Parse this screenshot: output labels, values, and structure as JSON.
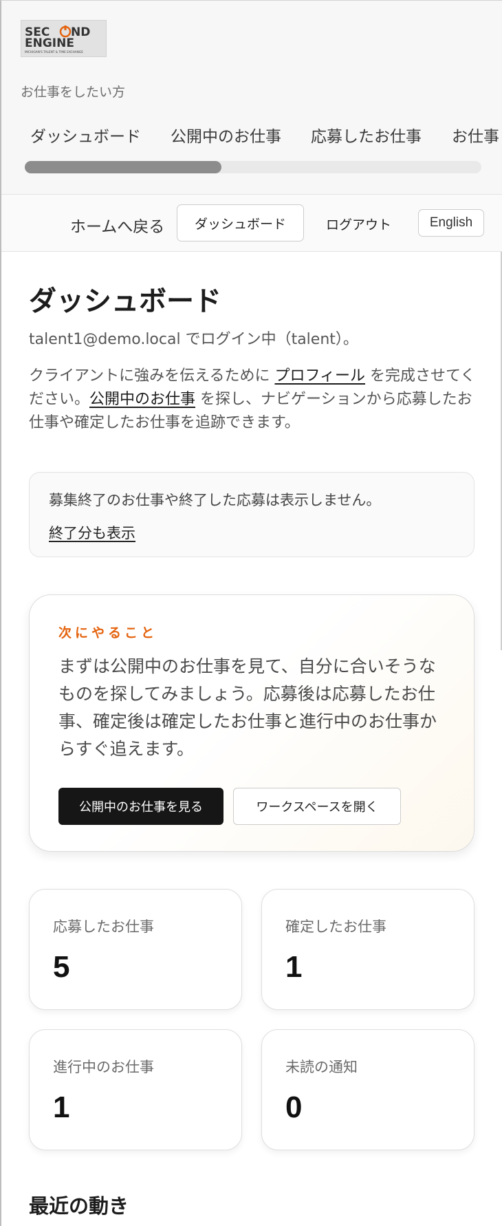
{
  "header": {
    "logo_text": "SECOND ENGINE",
    "logo_tagline": "MICHIGAN'S TALENT & TIME EXCHANGE",
    "audience_label": "お仕事をしたい方",
    "tabs": [
      {
        "label": "ダッシュボード"
      },
      {
        "label": "公開中のお仕事"
      },
      {
        "label": "応募したお仕事"
      },
      {
        "label": "お仕事"
      }
    ],
    "tab_scroll_fraction": 0.43
  },
  "nav": {
    "home": "ホームへ戻る",
    "dashboard": "ダッシュボード",
    "logout": "ログアウト",
    "language": "English"
  },
  "main": {
    "title": "ダッシュボード",
    "login_status": "talent1@demo.local でログイン中（talent）。",
    "intro_1": "クライアントに強みを伝えるために ",
    "intro_profile_link": "プロフィール",
    "intro_2": " を完成させてください。",
    "intro_jobs_link": "公開中のお仕事",
    "intro_3": " を探し、ナビゲーションから応募したお仕事や確定したお仕事を追跡できます。"
  },
  "notice": {
    "text": "募集終了のお仕事や終了した応募は表示しません。",
    "link": "終了分も表示"
  },
  "next_steps": {
    "eyebrow": "次にやること",
    "body": "まずは公開中のお仕事を見て、自分に合いそうなものを探してみましょう。応募後は応募したお仕事、確定後は確定したお仕事と進行中のお仕事からすぐ追えます。",
    "primary_button": "公開中のお仕事を見る",
    "secondary_button": "ワークスペースを開く"
  },
  "stats": {
    "applied": {
      "label": "応募したお仕事",
      "value": "5"
    },
    "confirmed": {
      "label": "確定したお仕事",
      "value": "1"
    },
    "in_progress": {
      "label": "進行中のお仕事",
      "value": "1"
    },
    "unread": {
      "label": "未読の通知",
      "value": "0"
    }
  },
  "recent": {
    "title": "最近の動き"
  },
  "colors": {
    "accent": "#e4630e",
    "primary_button": "#161616",
    "logo_orange": "#e4630e"
  }
}
